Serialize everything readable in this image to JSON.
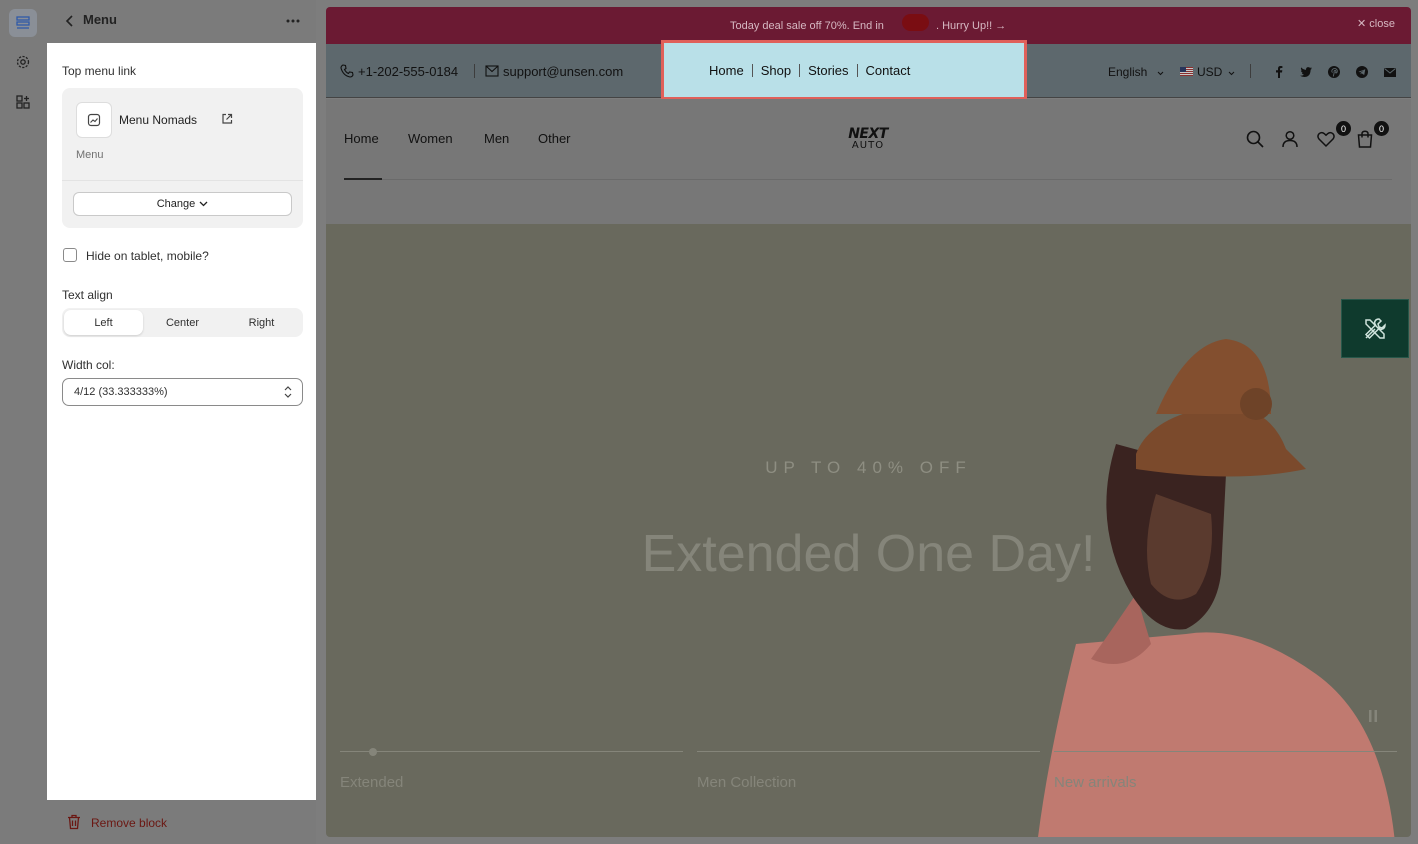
{
  "panel": {
    "title": "Menu",
    "top_menu_link_label": "Top menu link",
    "menu_name": "Menu Nomads",
    "menu_type": "Menu",
    "change_label": "Change",
    "hide_label": "Hide on tablet, mobile?",
    "text_align_label": "Text align",
    "align_options": [
      "Left",
      "Center",
      "Right"
    ],
    "align_selected": "Left",
    "width_label": "Width col:",
    "width_value": "4/12 (33.333333%)",
    "remove_label": "Remove block"
  },
  "preview": {
    "deal_text": "Today deal sale off 70%. End in",
    "hurry_text": ". Hurry Up!! →",
    "close_text": "✕ close",
    "phone": "+1-202-555-0184",
    "email": "support@unsen.com",
    "top_nav": [
      "Home",
      "Shop",
      "Stories",
      "Contact"
    ],
    "language": "English",
    "currency": "USD",
    "main_nav": [
      "Home",
      "Women",
      "Men",
      "Other"
    ],
    "logo_line1": "NEXT",
    "logo_line2": "AUTO",
    "wishlist_count": "0",
    "cart_count": "0",
    "promo": "UP TO 40% OFF",
    "headline": "Extended One Day!",
    "slide_tabs": [
      "Extended",
      "Men Collection",
      "New arrivals"
    ]
  },
  "colors": {
    "announcement_bg": "#6b1a33",
    "highlight_border": "#e0605a",
    "highlight_bg": "#b9e0e8"
  }
}
